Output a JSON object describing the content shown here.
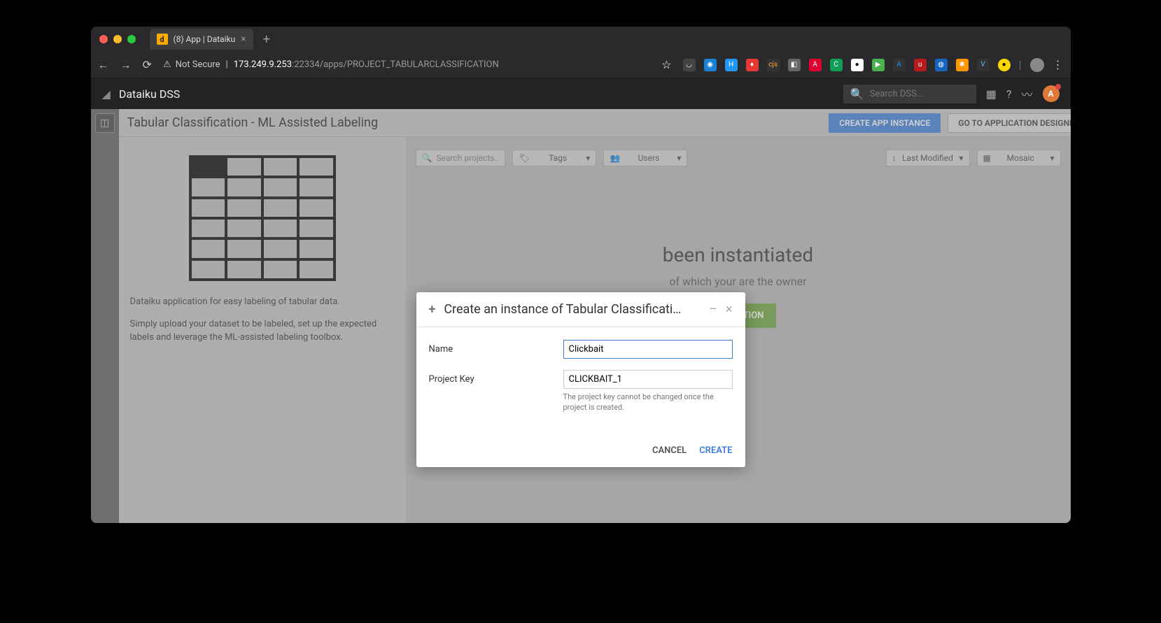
{
  "browser": {
    "tab_title": "(8) App | Dataiku",
    "not_secure": "Not Secure",
    "url_host": "173.249.9.253",
    "url_rest": ":22334/apps/PROJECT_TABULARCLASSIFICATION"
  },
  "header": {
    "brand": "Dataiku DSS",
    "search_placeholder": "Search DSS..."
  },
  "page": {
    "title": "Tabular Classification - ML Assisted Labeling",
    "create_instance_btn": "CREATE APP INSTANCE",
    "go_designer_btn": "GO TO APPLICATION DESIGNER"
  },
  "sidebar": {
    "desc1": "Dataiku application for easy labeling of tabular data.",
    "desc2": "Simply upload your dataset to be labeled, set up the expected labels and leverage the ML-assisted labeling toolbox."
  },
  "filters": {
    "search_placeholder": "Search projects..",
    "tags": "Tags",
    "users": "Users",
    "sort": "Last Modified",
    "view": "Mosaic"
  },
  "empty": {
    "heading": "been instantiated",
    "sub": "of which your are the owner",
    "button": "PPLICATION"
  },
  "modal": {
    "title": "Create an instance of Tabular Classificati…",
    "name_label": "Name",
    "name_value": "Clickbait",
    "key_label": "Project Key",
    "key_value": "CLICKBAIT_1",
    "key_hint": "The project key cannot be changed once the project is created.",
    "cancel": "CANCEL",
    "create": "CREATE"
  }
}
